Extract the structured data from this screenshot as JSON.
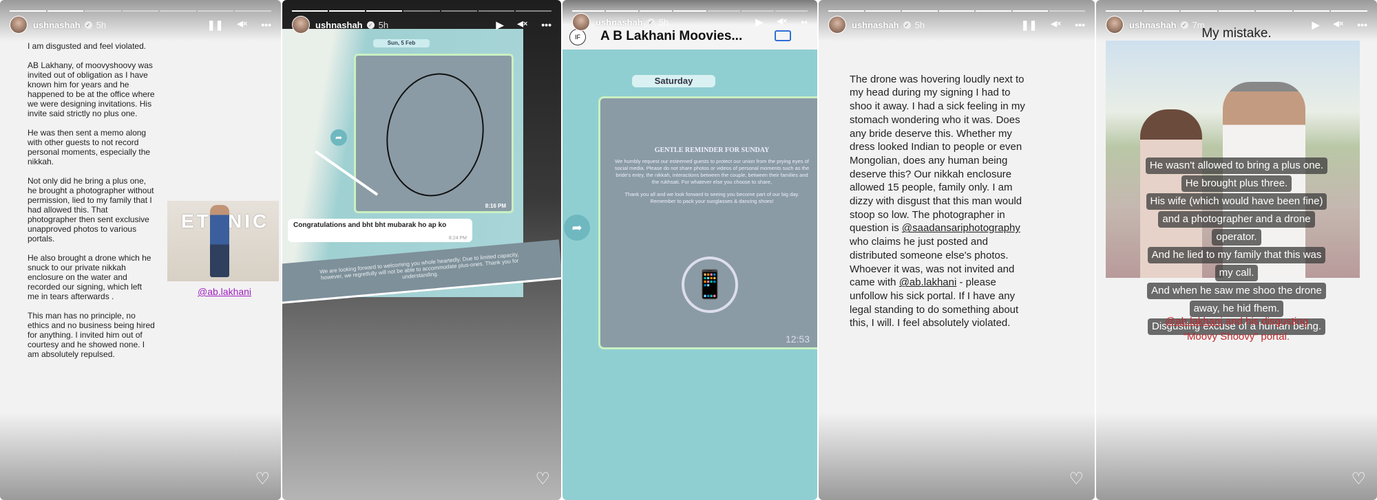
{
  "stories": [
    {
      "user": "ushnashah",
      "time": "5h",
      "controls": {
        "play": "❚❚",
        "mute": "🔇",
        "more": "•••"
      },
      "text": "I am disgusted and feel violated.\n\nAB Lakhany, of moovyshoovy was invited out of obligation as I have known him for years and he happened to be at the office where we were designing invitations. His invite said strictly no plus one.\n\nHe was then sent a memo along with other guests to not record personal moments, especially the nikkah.\n\nNot only did he bring a plus one, he brought a photographer without permission, lied to my family that I had allowed this. That photographer then sent exclusive unapproved photos to various portals.\n\nHe also brought a drone which he snuck to our private nikkah enclosure on the water and recorded our signing, which left me in tears afterwards .\n\nThis man has no principle, no ethics and no business being hired for anything. I invited him out of courtesy and he showed none. I am absolutely repulsed.",
      "photo_sign": "ETHNIC",
      "mention": "@ab.lakhani"
    },
    {
      "user": "ushnashah",
      "time": "5h",
      "controls": {
        "play": "▶",
        "mute": "🔇",
        "more": "•••"
      },
      "date_pill": "Sun, 5 Feb",
      "card_time": "8:16 PM",
      "bubble_text": "Congratulations and bht bht mubarak ho ap ko",
      "bubble_time": "8:24 PM",
      "banner": "We are looking forward to welcoming you whole heartedly. Due to limited capacity, however, we regretfully will not be able to accommodate plus-ones. Thank you for understanding."
    },
    {
      "user": "ushnashah",
      "time": "5h",
      "controls": {
        "play": "▶",
        "mute": "🔇",
        "more": "••"
      },
      "chat_title": "A B Lakhani Moovies...",
      "chat_logo": "IF",
      "day_pill": "Saturday",
      "card_title": "GENTLE REMINDER FOR SUNDAY",
      "card_text": "We humbly request our esteemed guests to protect our union from the prying eyes of social media. Please do not share photos or videos of personal moments such as the bride's entry, the nikkah, interactions between the couple, between their families and the rukhsati. For whatever else you choose to share,",
      "card_text2": "Thank you all and we look forward to seeing you become part of our big day. Remember to pack your sunglasses & dancing shoes!",
      "card_time": "12:53"
    },
    {
      "user": "ushnashah",
      "time": "5h",
      "controls": {
        "play": "❚❚",
        "mute": "🔇",
        "more": "•••"
      },
      "text_a": "The drone was hovering  loudly next to my head during my signing I had to shoo it away. I had a sick feeling in my stomach wondering who it was. Does any bride deserve this. Whether my dress looked Indian to people or even Mongolian, does any human being deserve this? Our nikkah enclosure allowed 15 people, family only. I am dizzy with disgust that this man would stoop so low. The photographer in question is ",
      "mention1": "@saadansariphotography",
      "text_b": "  who claims he just posted and distributed someone else's photos. Whoever it was, was not invited and came with ",
      "mention2": "@ab.lakhani",
      "text_c": "  - please unfollow his sick portal. If I have any legal standing to do something about this, I will. I feel absolutely violated."
    },
    {
      "user": "ushnashah",
      "time": "7m",
      "controls": {
        "play": "▶",
        "mute": "🔇",
        "more": "•••"
      },
      "heading": "My mistake.",
      "captions": [
        "He wasn't allowed to bring a plus one.",
        "He brought plus three.",
        "His wife (which would have been fine)",
        "and a photographer and a drone",
        "operator.",
        "And he lied to my family that this was",
        "my call.",
        "And when he saw me shoo the drone",
        "away, he hid fhem.",
        "Disgusting excuse of a human being."
      ],
      "mention": "@ab.lakhani",
      "red_text": " and his disgusting",
      "red_text2": "“Moovy Shoovy” portal."
    }
  ],
  "colors": {
    "mention": "#a020c0",
    "red": "#c0282d",
    "teal": "#8fcfd2",
    "card": "#8a9ba5"
  }
}
